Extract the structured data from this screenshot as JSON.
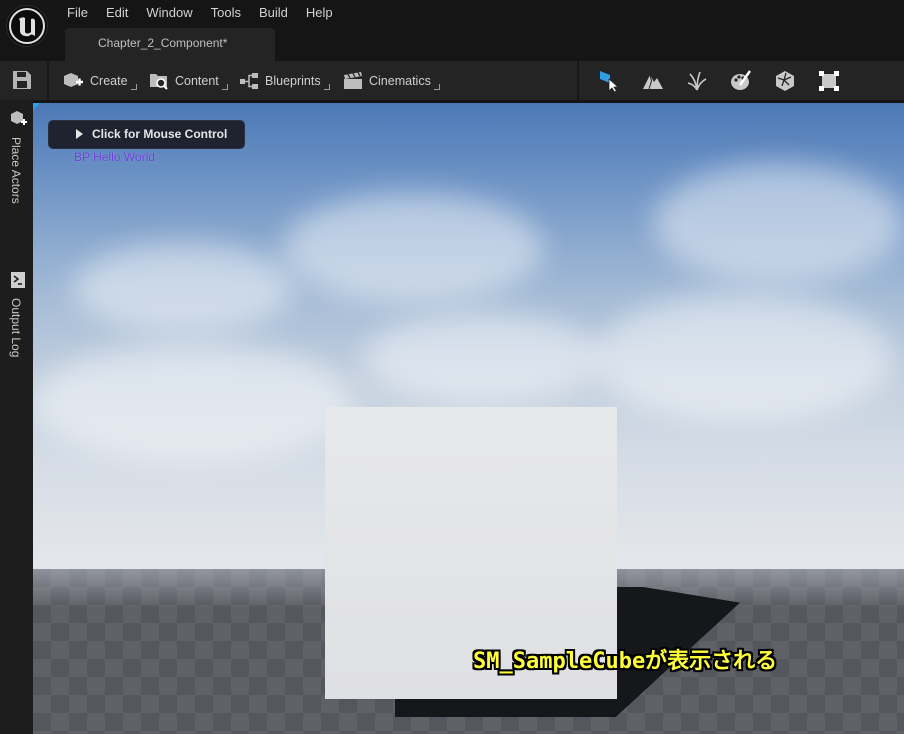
{
  "menu": {
    "items": [
      "File",
      "Edit",
      "Window",
      "Tools",
      "Build",
      "Help"
    ]
  },
  "document_tab": {
    "label": "Chapter_2_Component*"
  },
  "toolbar": {
    "save_icon": "save-icon",
    "groups": [
      {
        "label": "Create",
        "icon": "place-actor-icon"
      },
      {
        "label": "Content",
        "icon": "content-browser-icon"
      },
      {
        "label": "Blueprints",
        "icon": "blueprint-icon"
      },
      {
        "label": "Cinematics",
        "icon": "clapperboard-icon"
      }
    ],
    "modes": [
      {
        "name": "select-mode",
        "icon": "select-mode-icon",
        "active": true
      },
      {
        "name": "landscape-mode",
        "icon": "landscape-icon"
      },
      {
        "name": "foliage-mode",
        "icon": "foliage-icon"
      },
      {
        "name": "mesh-paint-mode",
        "icon": "mesh-paint-icon"
      },
      {
        "name": "fracture-mode",
        "icon": "fracture-icon"
      },
      {
        "name": "brush-editing-mode",
        "icon": "brush-editing-icon"
      }
    ],
    "accent_color": "#2ea0e6"
  },
  "sidebar": {
    "tabs": [
      {
        "label": "Place Actors",
        "icon": "place-actor-icon"
      },
      {
        "label": "Output Log",
        "icon": "output-log-icon"
      }
    ]
  },
  "viewport": {
    "mouse_control_label": "Click for Mouse Control",
    "actor_label": "BP Hello World",
    "caption": "SM_SampleCubeが表示される",
    "caption_color": "#ffff3a"
  }
}
